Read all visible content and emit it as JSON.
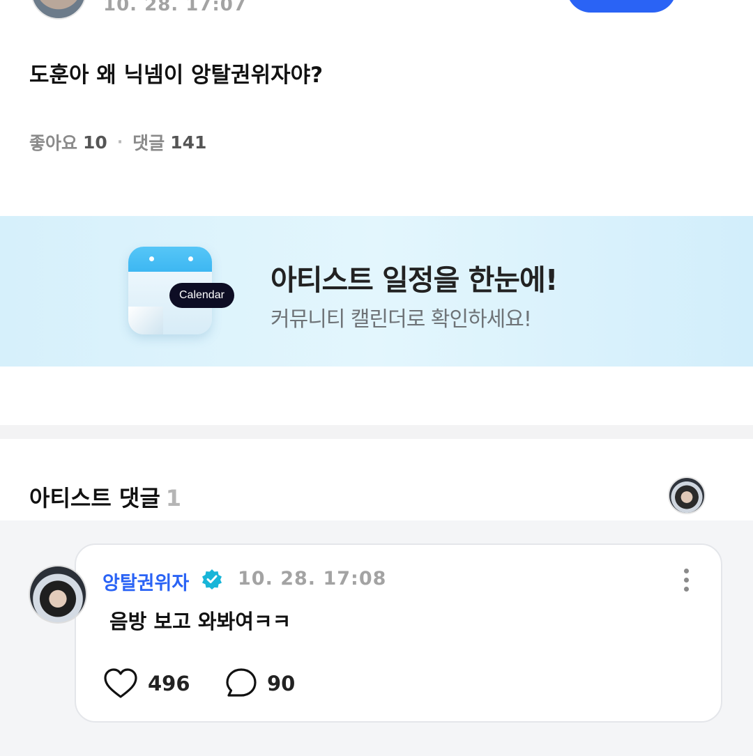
{
  "post": {
    "timestamp": "10. 28. 17:07",
    "title": "도훈아 왜 닉넴이 앙탈권위자야?",
    "likes_label": "좋아요",
    "likes_count": "10",
    "comments_label": "댓글",
    "comments_count": "141"
  },
  "banner": {
    "calendar_label": "Calendar",
    "title": "아티스트 일정을 한눈에!",
    "subtitle": "커뮤니티 캘린더로 확인하세요!"
  },
  "artist_comments": {
    "section_title": "아티스트 댓글",
    "count": "1",
    "items": [
      {
        "author": "앙탈권위자",
        "timestamp": "10. 28. 17:08",
        "text": "음방 보고 와봐여ㅋㅋ",
        "likes": "496",
        "replies": "90"
      }
    ]
  },
  "colors": {
    "accent": "#2a63f5",
    "verified": "#18b5d8",
    "muted_text": "#a3a3a3"
  },
  "icons": [
    "more-vertical-icon",
    "calendar-icon",
    "verified-badge-icon",
    "heart-icon",
    "speech-bubble-icon"
  ]
}
